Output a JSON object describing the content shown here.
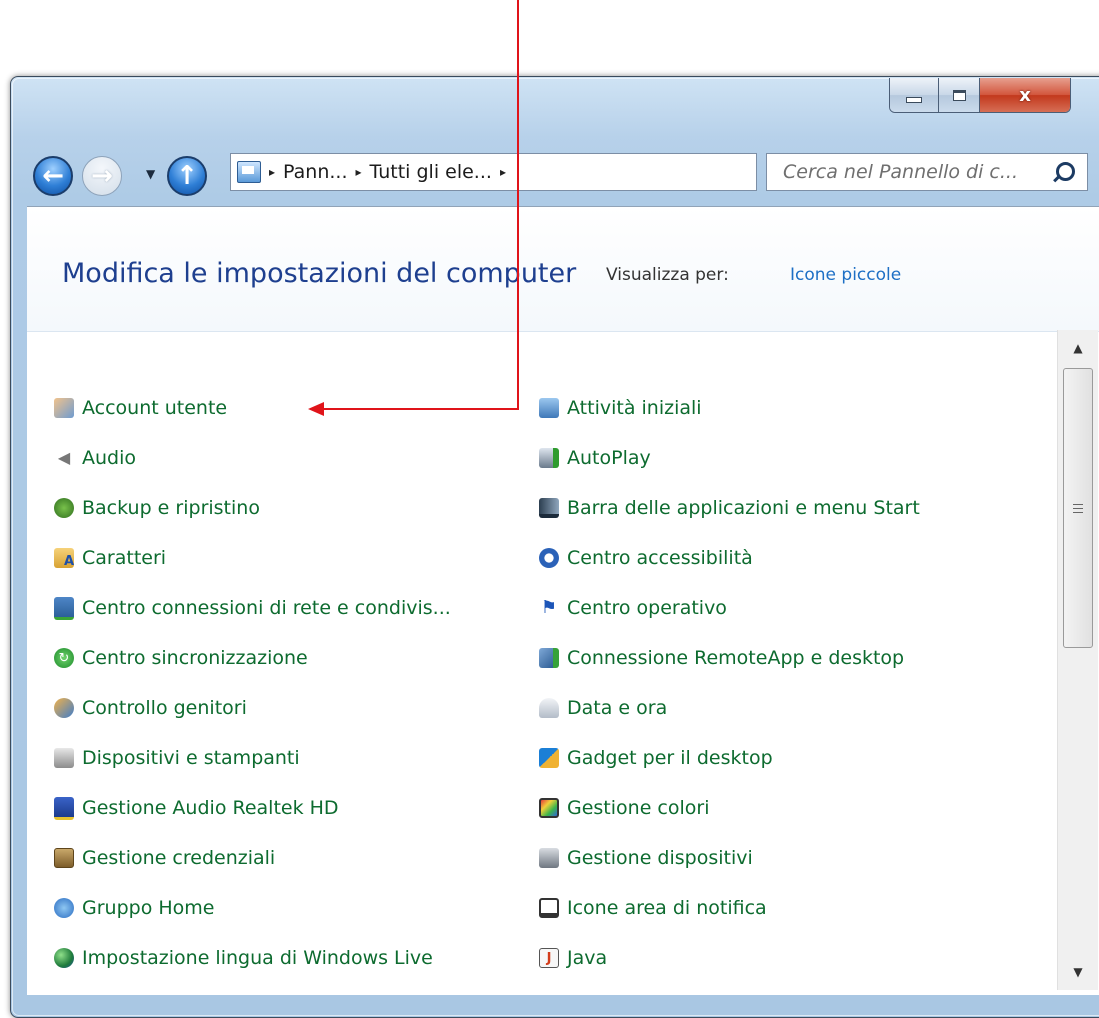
{
  "window": {
    "close_glyph": "x"
  },
  "nav": {
    "back_glyph": "←",
    "forward_glyph": "→",
    "up_glyph": "↑",
    "dropdown_glyph": "▼"
  },
  "address_bar": {
    "crumbs": [
      "Pann...",
      "Tutti gli ele..."
    ],
    "separator": "▸",
    "dropdown_glyph": "▼",
    "refresh_glyph": "↻"
  },
  "search": {
    "placeholder": "Cerca nel Pannello di c..."
  },
  "header": {
    "title": "Modifica le impostazioni del computer",
    "view_label": "Visualizza per:",
    "view_value": "Icone piccole"
  },
  "items_left": [
    {
      "label": "Account utente",
      "icon": "users-icon"
    },
    {
      "label": "Audio",
      "icon": "speaker-icon"
    },
    {
      "label": "Backup e ripristino",
      "icon": "backup-icon"
    },
    {
      "label": "Caratteri",
      "icon": "fonts-folder-icon"
    },
    {
      "label": "Centro connessioni di rete e condivis...",
      "icon": "network-icon"
    },
    {
      "label": "Centro sincronizzazione",
      "icon": "sync-icon"
    },
    {
      "label": "Controllo genitori",
      "icon": "parental-control-icon"
    },
    {
      "label": "Dispositivi e stampanti",
      "icon": "printer-icon"
    },
    {
      "label": "Gestione Audio Realtek HD",
      "icon": "realtek-audio-icon"
    },
    {
      "label": "Gestione credenziali",
      "icon": "credential-vault-icon"
    },
    {
      "label": "Gruppo Home",
      "icon": "homegroup-icon"
    },
    {
      "label": "Impostazione lingua di Windows Live",
      "icon": "globe-icon"
    }
  ],
  "items_right": [
    {
      "label": "Attività iniziali",
      "icon": "getting-started-icon"
    },
    {
      "label": "AutoPlay",
      "icon": "autoplay-icon"
    },
    {
      "label": "Barra delle applicazioni e menu Start",
      "icon": "taskbar-icon"
    },
    {
      "label": "Centro accessibilità",
      "icon": "accessibility-icon"
    },
    {
      "label": "Centro operativo",
      "icon": "flag-icon"
    },
    {
      "label": "Connessione RemoteApp e desktop",
      "icon": "remote-desktop-icon"
    },
    {
      "label": "Data e ora",
      "icon": "clock-icon"
    },
    {
      "label": "Gadget per il desktop",
      "icon": "gadget-icon"
    },
    {
      "label": "Gestione colori",
      "icon": "color-monitor-icon"
    },
    {
      "label": "Gestione dispositivi",
      "icon": "device-manager-icon"
    },
    {
      "label": "Icone area di notifica",
      "icon": "notification-area-icon"
    },
    {
      "label": "Java",
      "icon": "java-icon"
    }
  ],
  "scrollbar": {
    "up_glyph": "▲",
    "down_glyph": "▼"
  },
  "colors": {
    "item_text": "#0d6b2f",
    "title_text": "#1e3f8f",
    "link_text": "#1d6fc5",
    "annotation": "#e0141a"
  }
}
